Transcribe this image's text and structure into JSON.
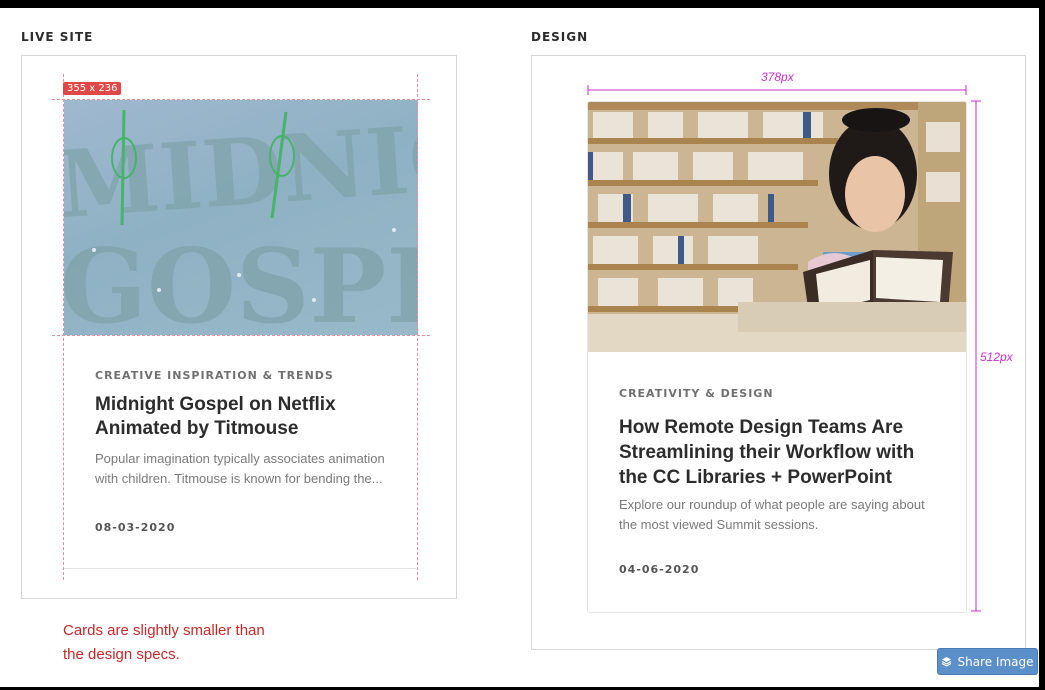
{
  "live_site": {
    "label": "LIVE SITE",
    "size_badge": "355 x 236",
    "card": {
      "category": "CREATIVE INSPIRATION & TRENDS",
      "title_line1": "Midnight Gospel on Netflix",
      "title_line2": "Animated by Titmouse",
      "desc_line1": "Popular imagination typically associates animation",
      "desc_line2": "with children. Titmouse is known for bending the...",
      "date": "08-03-2020",
      "image_text_top": "MIDNIGHT",
      "image_text_bottom": "GOSPEL"
    }
  },
  "design": {
    "label": "DESIGN",
    "width_dim": "378px",
    "height_dim": "512px",
    "card": {
      "category": "CREATIVITY & DESIGN",
      "title_line1": "How Remote Design Teams Are",
      "title_line2": "Streamlining their Workflow with",
      "title_line3": "the CC Libraries + PowerPoint",
      "desc_line1": "Explore our roundup of what people are saying about",
      "desc_line2": "the most viewed Summit sessions.",
      "date": "04-06-2020"
    }
  },
  "note": {
    "line1": "Cards are slightly smaller than",
    "line2": "the design specs."
  },
  "share_button": {
    "label": "Share Image",
    "icon": "layers-icon"
  },
  "colors": {
    "guide": "#f08a9a",
    "badge": "#e04848",
    "dimension": "#c92fc9",
    "note": "#c62828",
    "button": "#5b8fc9"
  }
}
